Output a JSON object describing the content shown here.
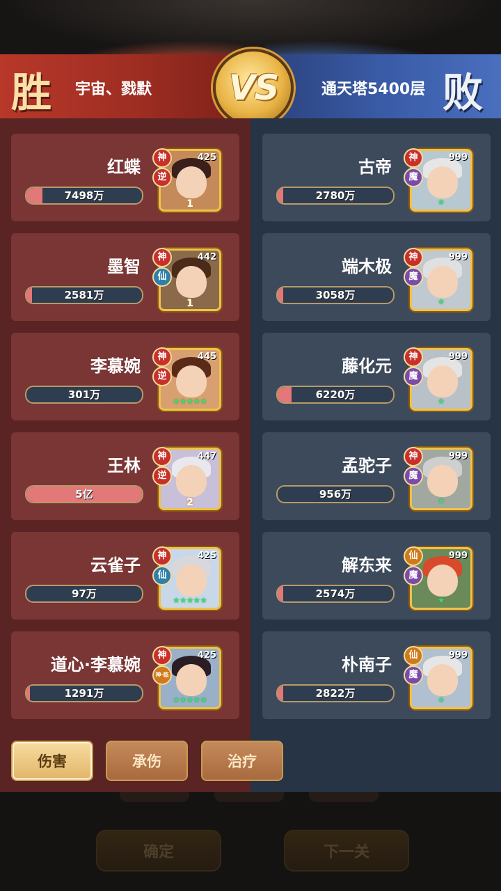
{
  "header": {
    "win_label": "胜",
    "lose_label": "败",
    "vs_label": "VS",
    "left_team": "宇宙、戮默",
    "right_team": "通天塔5400层"
  },
  "left": [
    {
      "name": "红蝶",
      "value": "7498万",
      "fill": 0.14,
      "level": "425",
      "badge1": "神",
      "badge2": "逆",
      "footer": "1"
    },
    {
      "name": "墨智",
      "value": "2581万",
      "fill": 0.05,
      "level": "442",
      "badge1": "神",
      "badge2": "仙",
      "footer": "1"
    },
    {
      "name": "李慕婉",
      "value": "301万",
      "fill": 0.0,
      "level": "445",
      "badge1": "神",
      "badge2": "逆",
      "footer": "★★★★★"
    },
    {
      "name": "王林",
      "value": "5亿",
      "fill": 1.0,
      "level": "447",
      "badge1": "神",
      "badge2": "逆",
      "footer": "2"
    },
    {
      "name": "云雀子",
      "value": "97万",
      "fill": 0.0,
      "level": "425",
      "badge1": "神",
      "badge2": "仙",
      "footer": "★★★★★"
    },
    {
      "name": "道心·李慕婉",
      "value": "1291万",
      "fill": 0.03,
      "level": "425",
      "badge1": "神",
      "badge2": "神·临",
      "footer": "★★★★★"
    }
  ],
  "right": [
    {
      "name": "古帝",
      "value": "2780万",
      "fill": 0.05,
      "level": "999",
      "badge1": "神",
      "badge2": "魔",
      "footer": "★"
    },
    {
      "name": "端木极",
      "value": "3058万",
      "fill": 0.05,
      "level": "999",
      "badge1": "神",
      "badge2": "魔",
      "footer": "★"
    },
    {
      "name": "藤化元",
      "value": "6220万",
      "fill": 0.12,
      "level": "999",
      "badge1": "神",
      "badge2": "魔",
      "footer": "★"
    },
    {
      "name": "孟驼子",
      "value": "956万",
      "fill": 0.0,
      "level": "999",
      "badge1": "神",
      "badge2": "魔",
      "footer": "★"
    },
    {
      "name": "解东来",
      "value": "2574万",
      "fill": 0.05,
      "level": "999",
      "badge1": "仙",
      "badge2": "魔",
      "footer": "★"
    },
    {
      "name": "朴南子",
      "value": "2822万",
      "fill": 0.05,
      "level": "999",
      "badge1": "仙",
      "badge2": "魔",
      "footer": "★"
    }
  ],
  "tabs": [
    "伤害",
    "承伤",
    "治疗"
  ],
  "buttons": {
    "confirm": "确定",
    "next": "下一关"
  },
  "colors": {
    "left_panel": "#5a2424",
    "right_panel": "#263445",
    "bar_fill": "#e37878"
  }
}
